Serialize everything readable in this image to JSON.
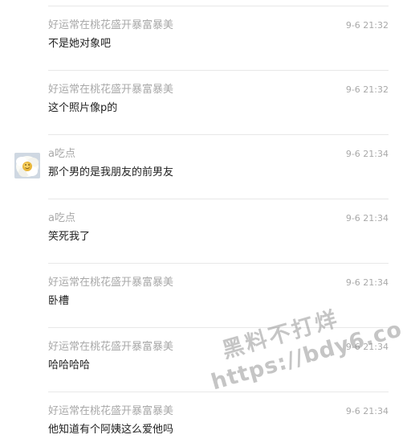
{
  "comments": [
    {
      "author": "好运常在桃花盛开暴富暴美",
      "time": "9-6 21:32",
      "text": "不是她对象吧",
      "has_avatar": false
    },
    {
      "author": "好运常在桃花盛开暴富暴美",
      "time": "9-6 21:32",
      "text": "这个照片像p的",
      "has_avatar": false
    },
    {
      "author": "a吃点",
      "time": "9-6 21:34",
      "text": "那个男的是我朋友的前男友",
      "has_avatar": true
    },
    {
      "author": "a吃点",
      "time": "9-6 21:34",
      "text": "笑死我了",
      "has_avatar": false
    },
    {
      "author": "好运常在桃花盛开暴富暴美",
      "time": "9-6 21:34",
      "text": "卧槽",
      "has_avatar": false
    },
    {
      "author": "好运常在桃花盛开暴富暴美",
      "time": "9-6 21:34",
      "text": "哈哈哈哈",
      "has_avatar": false
    },
    {
      "author": "好运常在桃花盛开暴富暴美",
      "time": "9-6 21:34",
      "text": "他知道有个阿姨这么爱他吗",
      "has_avatar": false
    }
  ],
  "watermark": {
    "line1": "黑料不打烊",
    "line2": "https://bdy6.co"
  }
}
